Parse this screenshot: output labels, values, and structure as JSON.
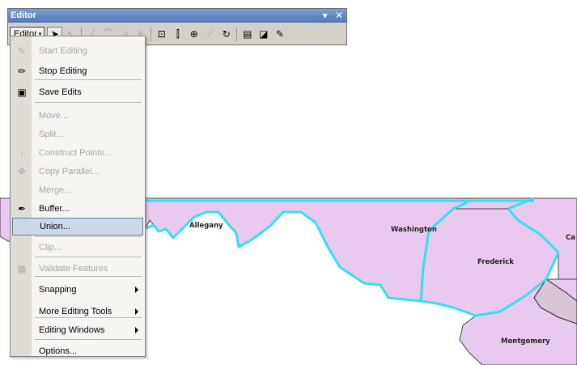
{
  "toolbar": {
    "title": "Editor",
    "controls": {
      "dropdown": "▾",
      "close": "✕"
    },
    "editor_button_label": "Editor",
    "editor_button_arrow": "▾",
    "buttons": [
      {
        "name": "edit-tool",
        "glyph": "➤",
        "icon": "arrow-pointer-icon",
        "state": "pressed"
      },
      {
        "name": "edit-annotation-tool",
        "glyph": "↖",
        "icon": "annotation-pointer-icon",
        "state": "disabled"
      },
      {
        "name": "straight-segment-tool",
        "glyph": "╱",
        "icon": "straight-segment-icon",
        "state": "disabled"
      },
      {
        "name": "arc-segment-tool",
        "glyph": "⌒",
        "icon": "arc-segment-icon",
        "state": "disabled"
      },
      {
        "name": "trace-tool",
        "glyph": "⊿",
        "icon": "trace-icon",
        "state": "disabled"
      },
      {
        "name": "point-tool",
        "glyph": "✳",
        "icon": "point-icon",
        "state": "disabled"
      },
      {
        "name": "edit-vertices-tool",
        "glyph": "⊡",
        "icon": "edit-vertices-icon",
        "state": "normal"
      },
      {
        "name": "reshape-tool",
        "glyph": "⫿",
        "icon": "reshape-icon",
        "state": "normal"
      },
      {
        "name": "cut-polygons-tool",
        "glyph": "⊕",
        "icon": "cut-polygons-icon",
        "state": "normal"
      },
      {
        "name": "split-tool",
        "glyph": "⁄",
        "icon": "split-icon",
        "state": "disabled"
      },
      {
        "name": "rotate-tool",
        "glyph": "↻",
        "icon": "rotate-icon",
        "state": "normal"
      },
      {
        "name": "attributes-button",
        "glyph": "▤",
        "icon": "attributes-icon",
        "state": "normal"
      },
      {
        "name": "sketch-properties-button",
        "glyph": "◪",
        "icon": "sketch-properties-icon",
        "state": "normal"
      },
      {
        "name": "create-features-button",
        "glyph": "✎",
        "icon": "create-features-icon",
        "state": "normal"
      }
    ]
  },
  "menu": {
    "items": [
      {
        "label": "Start Editing",
        "icon": "pencil-icon",
        "glyph": "✎",
        "disabled": true
      },
      {
        "label": "Stop Editing",
        "icon": "stop-editing-icon",
        "glyph": "✏",
        "disabled": false
      },
      {
        "label": "Save Edits",
        "icon": "save-edits-icon",
        "glyph": "▣",
        "disabled": false
      },
      {
        "label": "Move...",
        "disabled": true
      },
      {
        "label": "Split...",
        "disabled": true
      },
      {
        "label": "Construct Points...",
        "icon": "construct-points-icon",
        "glyph": "⋮",
        "disabled": true
      },
      {
        "label": "Copy Parallel...",
        "icon": "copy-parallel-icon",
        "glyph": "✥",
        "disabled": true
      },
      {
        "label": "Merge...",
        "disabled": true
      },
      {
        "label": "Buffer...",
        "icon": "buffer-icon",
        "glyph": "✒",
        "disabled": false
      },
      {
        "label": "Union...",
        "disabled": false,
        "highlighted": true
      },
      {
        "label": "Clip...",
        "disabled": true
      },
      {
        "label": "Validate Features",
        "icon": "validate-features-icon",
        "glyph": "▦",
        "disabled": true
      },
      {
        "label": "Snapping",
        "submenu": true,
        "disabled": false
      },
      {
        "label": "More Editing Tools",
        "submenu": true,
        "disabled": false
      },
      {
        "label": "Editing Windows",
        "submenu": true,
        "disabled": false
      },
      {
        "label": "Options...",
        "disabled": false
      }
    ]
  },
  "map": {
    "fill_color": "#e9c9ef",
    "outline_color": "#33e0f0",
    "labels": [
      "Allegany",
      "Washington",
      "Frederick",
      "Montgomery",
      "Ca"
    ]
  }
}
